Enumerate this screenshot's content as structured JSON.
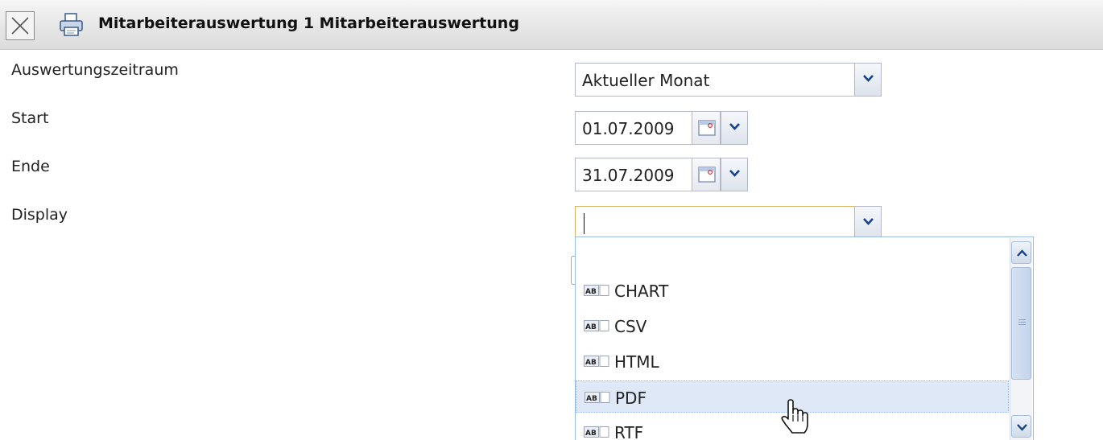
{
  "window": {
    "title": "Mitarbeiterauswertung 1 Mitarbeiterauswertung",
    "close_icon": "close-icon",
    "print_icon": "printer-icon"
  },
  "form": {
    "period": {
      "label": "Auswertungszeitraum",
      "value": "Aktueller Monat"
    },
    "start": {
      "label": "Start",
      "value": "01.07.2009"
    },
    "end": {
      "label": "Ende",
      "value": "31.07.2009"
    },
    "display": {
      "label": "Display",
      "value": ""
    }
  },
  "dropdown": {
    "options": [
      {
        "label": ""
      },
      {
        "label": "CHART"
      },
      {
        "label": "CSV"
      },
      {
        "label": "HTML"
      },
      {
        "label": "PDF"
      },
      {
        "label": "RTF"
      }
    ],
    "hovered": "PDF",
    "item_icon": "text-field-icon"
  },
  "colors": {
    "focus_border": "#d5b264",
    "hover_background": "#dfe8f6",
    "border": "#b5b8c8"
  }
}
